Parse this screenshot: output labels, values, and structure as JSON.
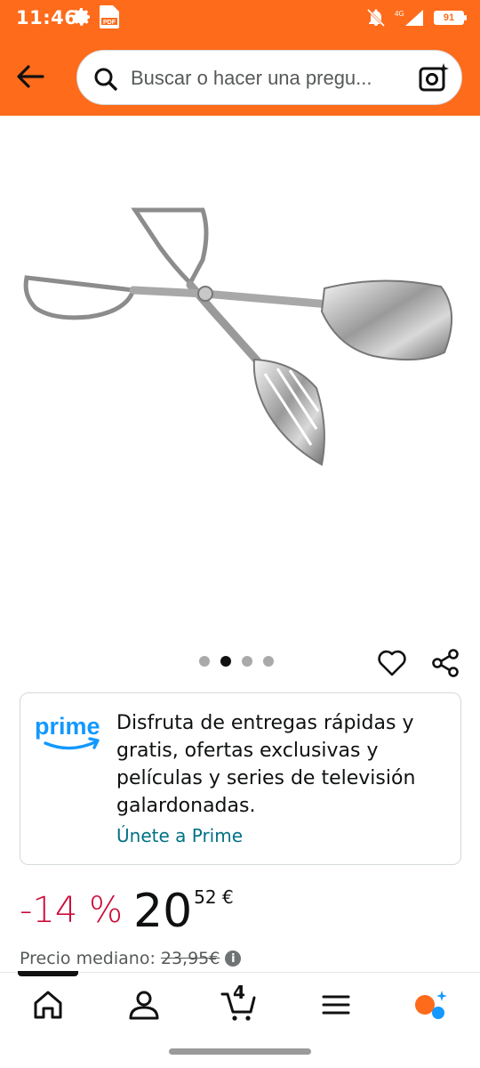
{
  "status_bar": {
    "time": "11:46",
    "battery": "91"
  },
  "header": {
    "search_placeholder": "Buscar o hacer una pregu..."
  },
  "product": {
    "image_icon": "salad-tongs-image",
    "carousel": {
      "total": 4,
      "active_index": 1
    }
  },
  "prime": {
    "logo_text": "prime",
    "description": "Disfruta de entregas rápidas y gratis, ofertas exclusivas y películas y series de televisión galardonadas.",
    "link": "Únete a Prime"
  },
  "price": {
    "discount": "-14 %",
    "whole": "20",
    "fraction": "52 €",
    "median_label": "Precio mediano:",
    "old_price": "23,95€",
    "info_icon": "i"
  },
  "bottom_nav": {
    "cart_count": "4",
    "items": [
      "home-icon",
      "account-icon",
      "cart-icon",
      "menu-icon",
      "assistant-icon"
    ]
  },
  "colors": {
    "brand_orange": "#fe6b1b",
    "discount_red": "#cc0c39",
    "link_teal": "#007185",
    "prime_blue": "#1399ff"
  }
}
